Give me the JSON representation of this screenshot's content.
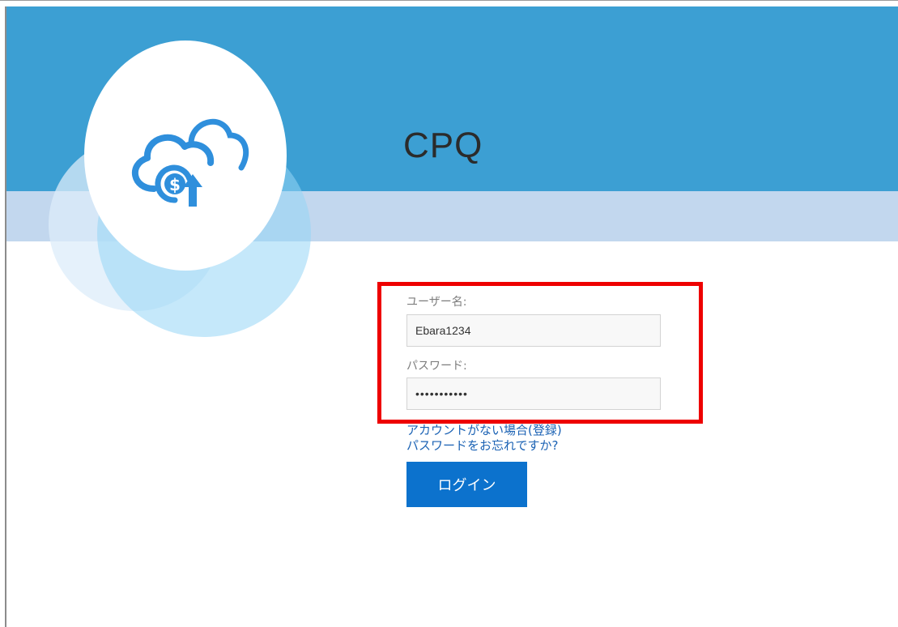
{
  "app": {
    "title": "CPQ",
    "logo_icon": "cloud-dollar-upload-icon"
  },
  "login_form": {
    "username": {
      "label": "ユーザー名:",
      "value": "Ebara1234"
    },
    "password": {
      "label": "パスワード:",
      "value": "•••••••••••"
    },
    "register_link": "アカウントがない場合(登録)",
    "forgot_password_link": "パスワードをお忘れですか?",
    "login_button": "ログイン"
  },
  "colors": {
    "header": "#3c9fd3",
    "subheader": "#c2d7ee",
    "highlight": "#ee0000",
    "button": "#0c72cd",
    "link": "#1b62b4",
    "logo_icon": "#2f8fdc"
  }
}
